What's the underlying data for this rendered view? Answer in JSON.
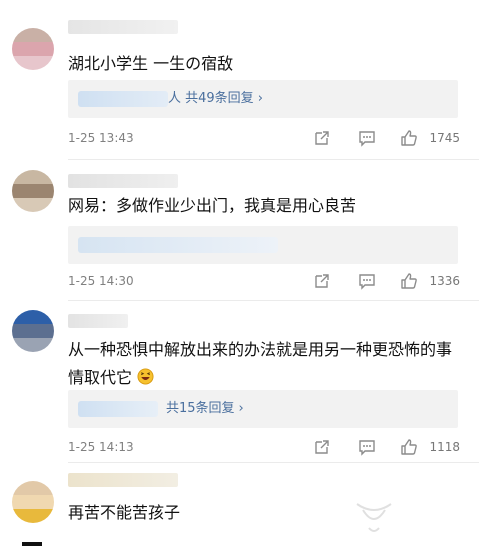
{
  "comments": [
    {
      "text": "湖北小学生 一生の宿敌",
      "reply_summary": "人 共49条回复",
      "time": "1-25 13:43",
      "likes": "1745"
    },
    {
      "text": "网易：多做作业少出门，我真是用心良苦",
      "reply_summary": "",
      "time": "1-25 14:30",
      "likes": "1336"
    },
    {
      "text": "从一种恐惧中解放出来的办法就是用另一种更恐怖的事情取代它",
      "reply_summary": "共15条回复",
      "time": "1-25 14:13",
      "likes": "1118"
    },
    {
      "text": "再苦不能苦孩子",
      "reply_summary": "",
      "time": "",
      "likes": ""
    }
  ],
  "icons": {
    "share": "share-icon",
    "comment": "comment-icon",
    "like": "thumbs-up-icon",
    "emoji": "laughing-emoji-icon",
    "reply_more": "chevron-right-icon"
  },
  "colors": {
    "link_blue": "#4a6f9e",
    "meta_gray": "#808080",
    "reply_bg": "#f2f2f2"
  }
}
